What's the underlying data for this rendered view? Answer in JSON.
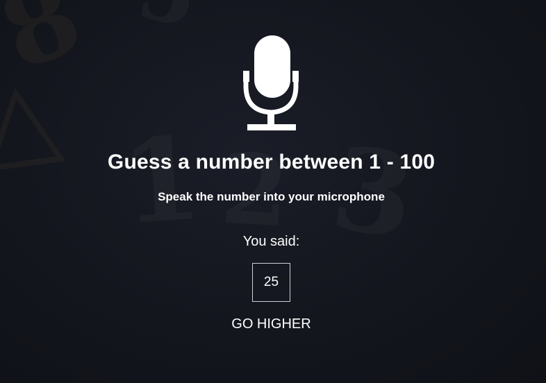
{
  "game": {
    "title": "Guess a number between 1 - 100",
    "subtitle": "Speak the number into your microphone",
    "you_said_label": "You said:",
    "spoken_number": "25",
    "feedback": "GO HIGHER"
  },
  "icons": {
    "microphone": "microphone-icon"
  },
  "colors": {
    "background": "#14161e",
    "text": "#ffffff",
    "box_border": "#cfd0d4"
  }
}
